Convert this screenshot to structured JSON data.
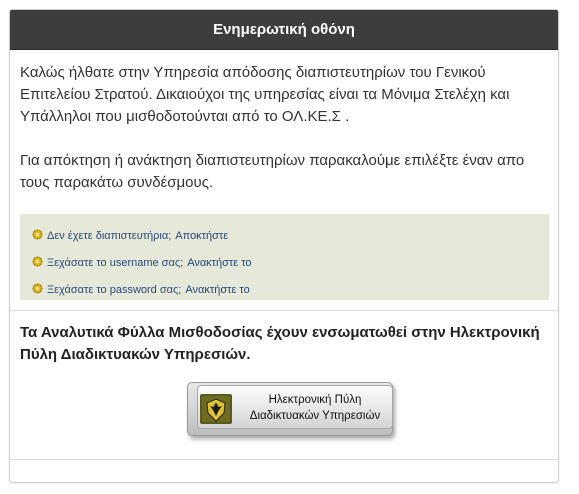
{
  "header": {
    "title": "Ενημερωτική οθόνη"
  },
  "intro": {
    "paragraph1": "Καλώς ήλθατε στην Υπηρεσία απόδοσης διαπιστευτηρίων του Γενικού Επιτελείου Στρατού. Δικαιούχοι της υπηρεσίας είναι τα Μόνιμα Στελέχη και Υπάλληλοι που μισθοδοτούνται από το ΟΛ.ΚΕ.Σ .",
    "paragraph2": "Για απόκτηση ή ανάκτηση διαπιστευτηρίων παρακαλούμε επιλέξτε έναν απο τους παρακάτω συνδέσμους."
  },
  "links": [
    {
      "question": "Δεν έχετε διαπιστευτήρια;",
      "action": "Αποκτήστε"
    },
    {
      "question": "Ξεχάσατε το username σας;",
      "action": "Ανακτήστε το"
    },
    {
      "question": "Ξεχάσατε το password σας;",
      "action": "Ανακτήστε το"
    }
  ],
  "notice": {
    "text": "Τα Αναλυτικά Φύλλα Μισθοδοσίας έχουν ενσωματωθεί στην Ηλεκτρονική Πύλη Διαδικτυακών Υπηρεσιών."
  },
  "portal_button": {
    "line1": "Ηλεκτρονική Πύλη",
    "line2": "Διαδικτυακών Υπηρεσιών",
    "logo_icon": "army-eagle-emblem-icon"
  },
  "colors": {
    "header_bg": "#3d3d3d",
    "links_bg": "#e6e8da",
    "link_text": "#2a4a7c",
    "bullet": "#d8b51c"
  }
}
